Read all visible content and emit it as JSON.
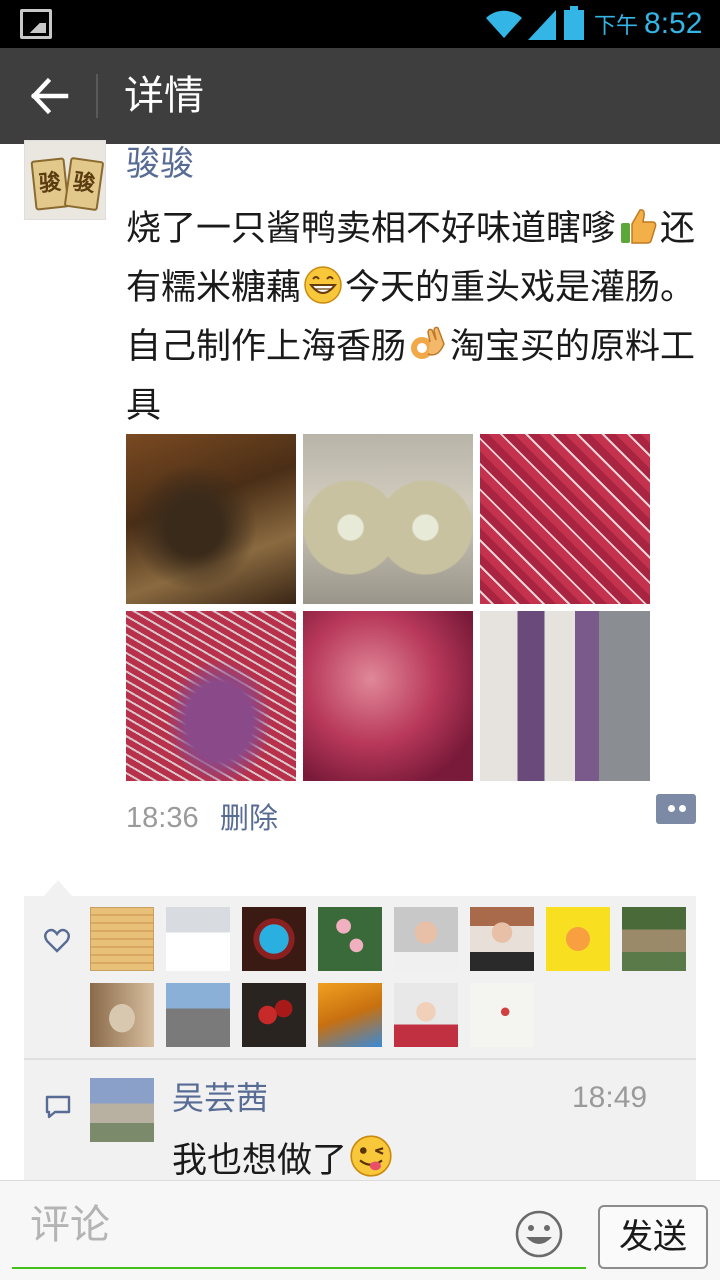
{
  "status_bar": {
    "ampm": "下午",
    "time": "8:52",
    "icons": [
      "gallery-icon",
      "wifi-icon",
      "signal-icon",
      "battery-icon"
    ]
  },
  "action_bar": {
    "title": "详情",
    "back_icon": "arrow-left-icon"
  },
  "post": {
    "author": "骏骏",
    "avatar_text": [
      "骏",
      "骏"
    ],
    "text_segments": [
      "烧了一只酱鸭卖相不好味道瞎嗲",
      "还有糯米糖藕",
      "今天的重头戏是灌肠。自己制作上海香肠",
      "淘宝买的原料工具"
    ],
    "emojis": [
      "thumbs-up-emoji",
      "grin-emoji",
      "ok-hand-emoji"
    ],
    "photo_count": 6,
    "time": "18:36",
    "delete_label": "删除"
  },
  "likes": {
    "icon": "heart-icon",
    "count": 14
  },
  "comments": [
    {
      "name": "吴芸茜",
      "time": "18:49",
      "text": "我也想做了",
      "emoji": "wink-tongue-emoji"
    }
  ],
  "input_bar": {
    "placeholder": "评论",
    "send_label": "发送"
  },
  "colors": {
    "link_blue": "#576b95",
    "action_bar": "#3e3e3e",
    "status_accent": "#33b5e5",
    "input_underline": "#45c01a"
  }
}
